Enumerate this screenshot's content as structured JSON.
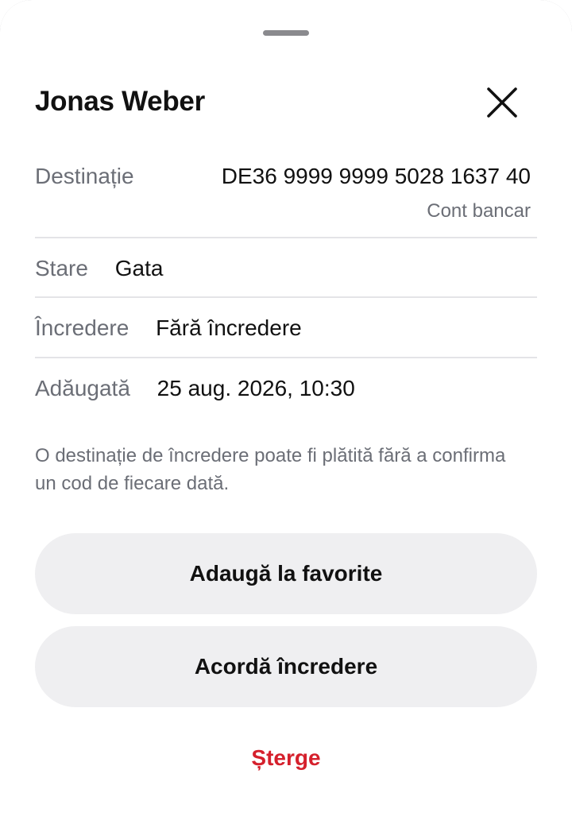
{
  "sheet": {
    "title": "Jonas Weber",
    "close_icon": "close-icon"
  },
  "details": {
    "destination_label": "Destinație",
    "destination_value": "DE36 9999 9999 5028 1637 40",
    "destination_type": "Cont bancar",
    "status_label": "Stare",
    "status_value": "Gata",
    "trust_label": "Încredere",
    "trust_value": "Fără încredere",
    "added_label": "Adăugată",
    "added_value": "25 aug. 2026, 10:30"
  },
  "note": "O destinație de încredere poate fi plătită fără a confirma un cod de fiecare dată.",
  "actions": {
    "favorite_label": "Adaugă la favorite",
    "trust_label": "Acordă încredere",
    "delete_label": "Șterge"
  },
  "colors": {
    "danger": "#d5202c",
    "button_bg": "#efeff1",
    "muted_text": "#6b6e76"
  }
}
